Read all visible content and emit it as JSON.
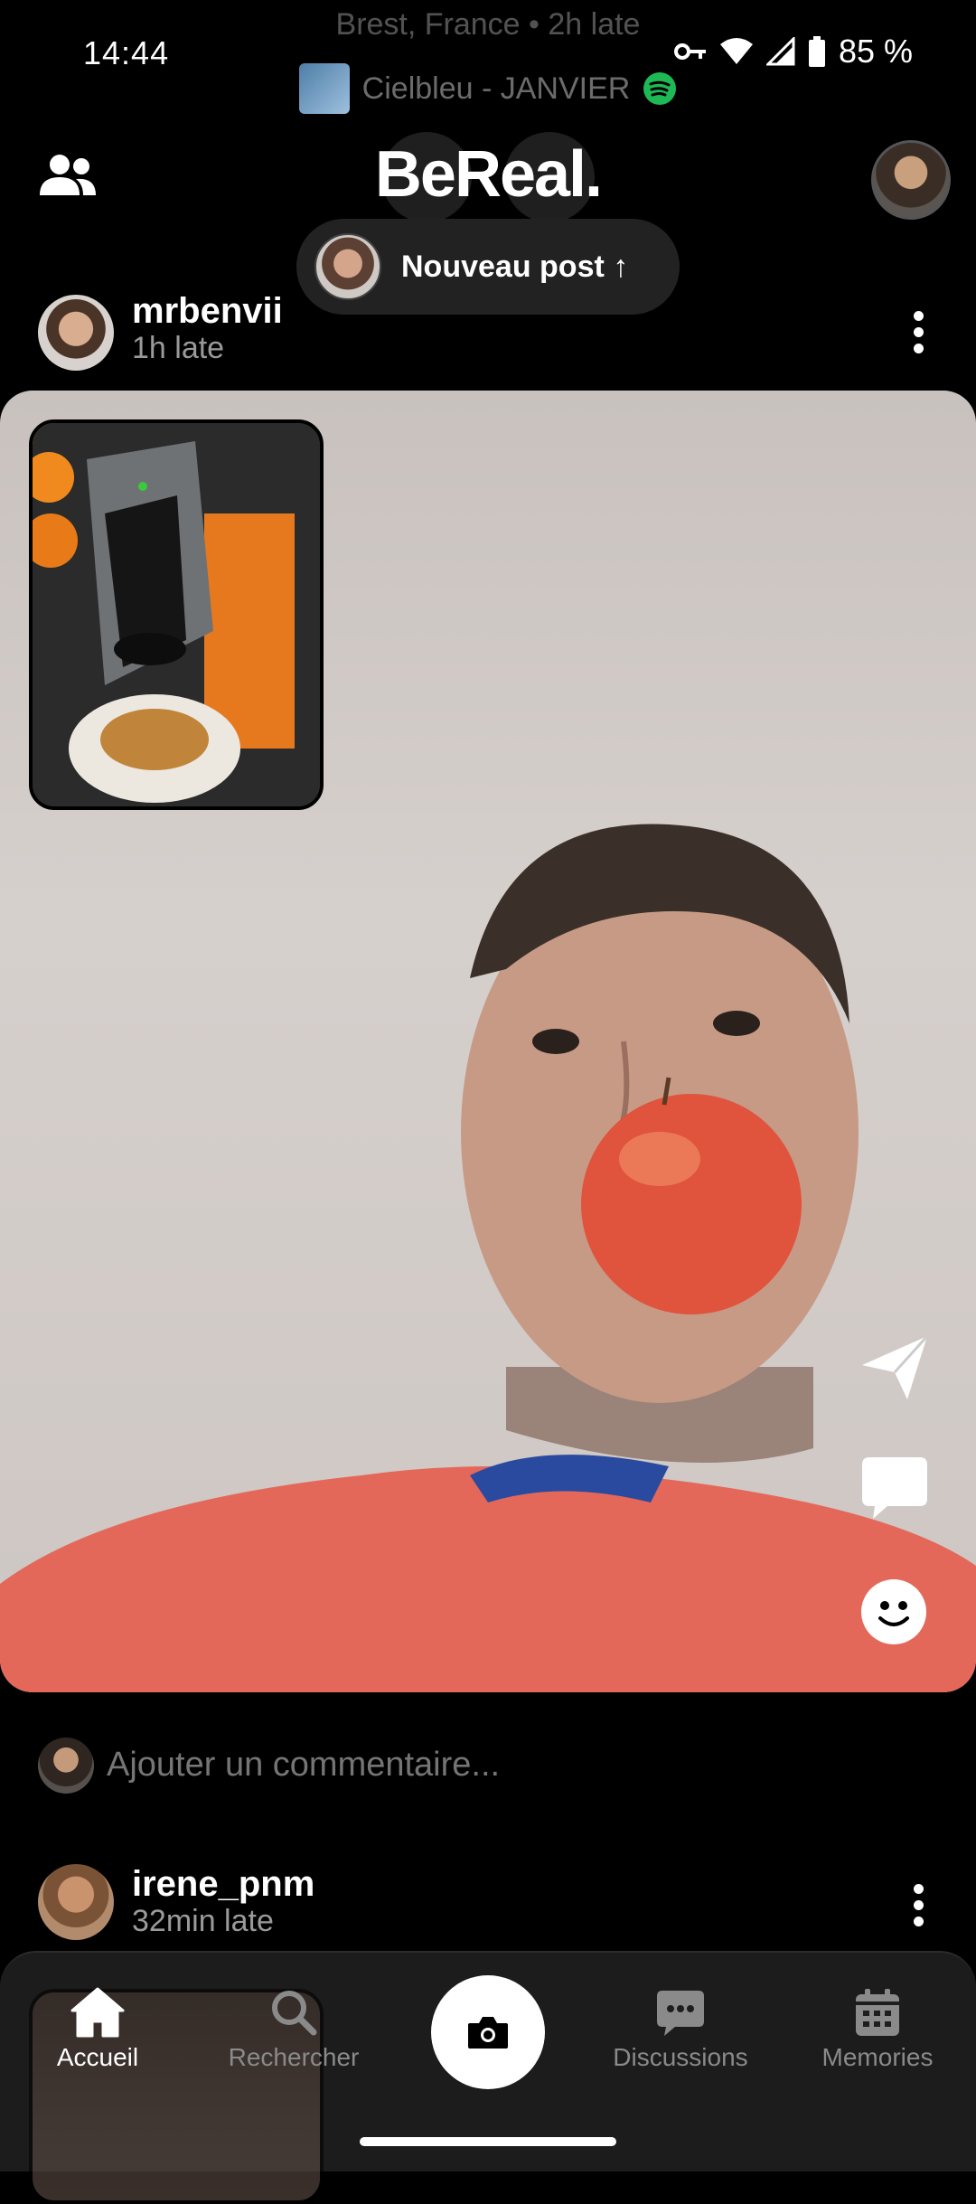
{
  "status_bar": {
    "time": "14:44",
    "battery": "85 %"
  },
  "top_info": {
    "location_line": "Brest, France • 2h late",
    "music_track": "Cielbleu - JANVIER"
  },
  "header": {
    "logo_text": "BeReal.",
    "new_post_label": "Nouveau post ↑"
  },
  "post1": {
    "username": "mrbenvii",
    "late": "1h late"
  },
  "comment": {
    "placeholder": "Ajouter un commentaire..."
  },
  "post2": {
    "username": "irene_pnm",
    "late": "32min late"
  },
  "bottom_nav": {
    "items": [
      {
        "label": "Accueil",
        "active": true
      },
      {
        "label": "Rechercher",
        "active": false
      },
      {
        "label": "Discussions",
        "active": false
      },
      {
        "label": "Memories",
        "active": false
      }
    ]
  },
  "colors": {
    "background": "#000000",
    "nav_inactive": "#8a8a8a",
    "spotify_green": "#1db954"
  }
}
